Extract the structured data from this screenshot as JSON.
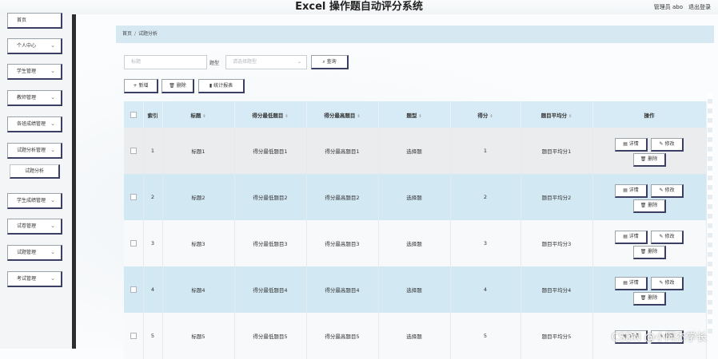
{
  "header": {
    "title": "Excel 操作题自动评分系统",
    "user": "管理员 abo",
    "logout": "退出登录"
  },
  "sidebar": {
    "items": [
      {
        "label": "首页",
        "chev": ""
      },
      {
        "label": "个人中心",
        "chev": "⌄"
      },
      {
        "label": "学生管理",
        "chev": "⌄"
      },
      {
        "label": "教师管理",
        "chev": "⌄"
      },
      {
        "label": "各班成绩管理",
        "chev": "⌄"
      },
      {
        "label": "试题分析管理",
        "chev": "⌄"
      },
      {
        "label": "学生成绩管理",
        "chev": "⌄"
      },
      {
        "label": "试卷管理",
        "chev": "⌄"
      },
      {
        "label": "试题管理",
        "chev": "⌄"
      },
      {
        "label": "考试管理",
        "chev": "⌄"
      }
    ],
    "sub_item": "试题分析"
  },
  "breadcrumb": {
    "home": "首页",
    "sep": "/",
    "current": "试题分析"
  },
  "search": {
    "title_placeholder": "标题",
    "type_label": "题型",
    "type_placeholder": "请选择题型",
    "query_label": "⌕ 查询"
  },
  "toolbar": {
    "add": "+ 新增",
    "delete": "🗑 删除",
    "stats": "▮ 统计报表"
  },
  "table": {
    "headers": [
      "索引",
      "标题",
      "得分最低题目",
      "得分最高题目",
      "题型",
      "得分",
      "题目平均分",
      "操作"
    ],
    "rows": [
      [
        "1",
        "标题1",
        "得分最低题目1",
        "得分最高题目1",
        "选择题",
        "1",
        "题目平均分1"
      ],
      [
        "2",
        "标题2",
        "得分最低题目2",
        "得分最高题目2",
        "选择题",
        "2",
        "题目平均分2"
      ],
      [
        "3",
        "标题3",
        "得分最低题目3",
        "得分最高题目3",
        "选择题",
        "3",
        "题目平均分3"
      ],
      [
        "4",
        "标题4",
        "得分最低题目4",
        "得分最高题目4",
        "选择题",
        "4",
        "题目平均分4"
      ],
      [
        "5",
        "标题5",
        "得分最低题目5",
        "得分最高题目5",
        "选择题",
        "5",
        "题目平均分5"
      ]
    ],
    "actions": {
      "detail": "▤ 详情",
      "edit": "✎ 修改",
      "delete": "🗑 删除"
    }
  },
  "watermark": "CSDN @小阿杰学长"
}
